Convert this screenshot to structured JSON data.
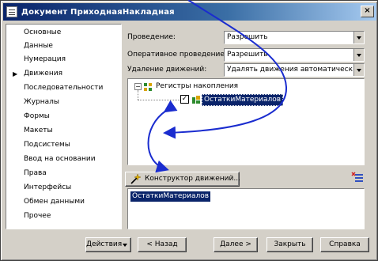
{
  "window": {
    "title": "Документ ПриходнаяНакладная",
    "close_label": "×"
  },
  "sidebar": {
    "items": [
      {
        "label": "Основные"
      },
      {
        "label": "Данные"
      },
      {
        "label": "Нумерация"
      },
      {
        "label": "Движения",
        "active": true
      },
      {
        "label": "Последовательности"
      },
      {
        "label": "Журналы"
      },
      {
        "label": "Формы"
      },
      {
        "label": "Макеты"
      },
      {
        "label": "Подсистемы"
      },
      {
        "label": "Ввод на основании"
      },
      {
        "label": "Права"
      },
      {
        "label": "Интерфейсы"
      },
      {
        "label": "Обмен данными"
      },
      {
        "label": "Прочее"
      }
    ],
    "active_marker": "▶"
  },
  "settings": {
    "posting_label": "Проведение:",
    "posting_value": "Разрешить",
    "realtime_label": "Оперативное проведение:",
    "realtime_value": "Разрешить",
    "delete_label": "Удаление движений:",
    "delete_value": "Удалять движения автоматическ"
  },
  "tree": {
    "expander": "−",
    "root_label": "Регистры накопления",
    "checkbox": "✓",
    "child_label": "ОстаткиМатериалов"
  },
  "constructor_button": {
    "label": "Конструктор движений..."
  },
  "result_list": {
    "selected": "ОстаткиМатериалов"
  },
  "footer": {
    "actions_label": "Действия",
    "back_label": "< Назад",
    "next_label": "Далее >",
    "close_label": "Закрыть",
    "help_label": "Справка"
  },
  "colors": {
    "selection": "#0a246a",
    "annotation_arrow": "#1a2ccf",
    "window_bg": "#d4d0c8"
  },
  "icons": {
    "window": "document-icon",
    "register": "register-tree-icon",
    "constructor": "wand-icon",
    "tool": "list-settings-icon"
  }
}
